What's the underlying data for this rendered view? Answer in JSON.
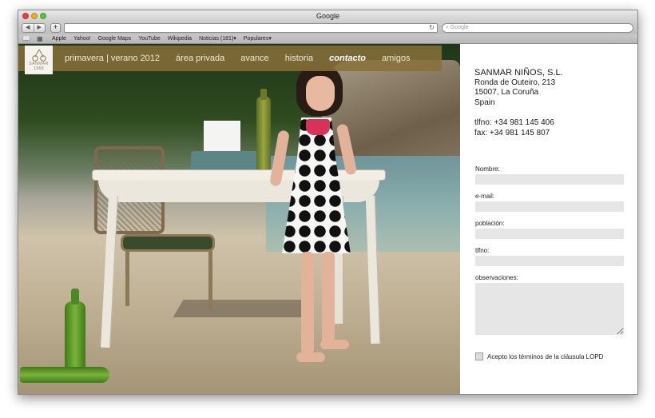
{
  "browser": {
    "title": "Google",
    "nav_back": "◀",
    "nav_forward": "▶",
    "add_label": "+",
    "url_value": "",
    "reload_icon": "↻",
    "search_placeholder": "Google"
  },
  "bookmarks": {
    "reader_icon": "📖",
    "grid_icon": "▦",
    "items": [
      "Apple",
      "Yahoo!",
      "Google Maps",
      "YouTube",
      "Wikipedia",
      "Noticias (181)▾",
      "Populares▾"
    ]
  },
  "site": {
    "logo_text": "SANMAR",
    "logo_year": "1968",
    "menu": [
      "primavera | verano 2012",
      "área privada",
      "avance",
      "historia",
      "contacto",
      "amigos"
    ],
    "menu_active": "contacto",
    "menu_color": "#87703a"
  },
  "contact": {
    "company_name": "SANMAR NIÑOS, S.L.",
    "address_line1": "Ronda de Outeiro, 213",
    "address_line2": "15007, La Coruña",
    "country": "Spain",
    "phone": "tlfno: +34 981 145 406",
    "fax": "fax: +34 981 145 807"
  },
  "form": {
    "name_label": "Nombre:",
    "email_label": "e-mail:",
    "city_label": "población:",
    "phone_label": "tlfno:",
    "notes_label": "observaciones:",
    "terms_label": "Acepto los términos de la cláusula LOPD"
  }
}
